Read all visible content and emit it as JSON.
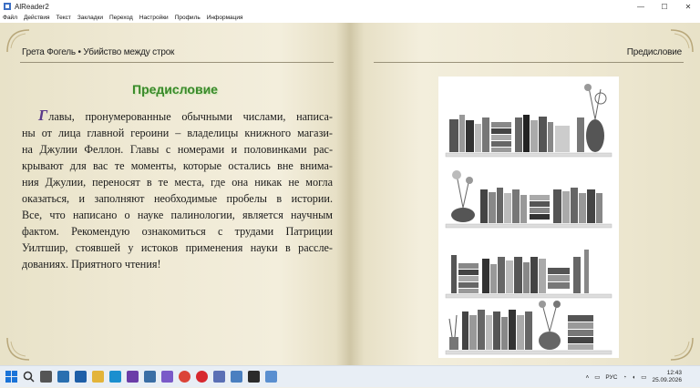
{
  "window": {
    "title": "AlReader2",
    "minimize_label": "—",
    "maximize_label": "☐",
    "close_label": "✕"
  },
  "menu": [
    "Файл",
    "Действия",
    "Текст",
    "Закладки",
    "Переход",
    "Настройки",
    "Профиль",
    "Информация"
  ],
  "book": {
    "left_header": "Грета Фогель  • Убийство между строк",
    "right_header": "Предисловие",
    "chapter_title": "Предисловие",
    "dropcap": "Г",
    "lines": [
      "лавы, пронумерованные обычными числами, написа-",
      "ны от лица главной героини – владелицы книжного магази-",
      "на Джулии Феллон. Главы с номерами и половинками рас-",
      "крывают для вас те моменты, которые остались вне внима-",
      "ния Джулии, переносят в те места, где она никак не могла",
      "оказаться, и заполняют необходимые пробелы в истории.",
      "Все, что написано о науке палинологии, является научным",
      "фактом. Рекомендую ознакомиться с трудами Патриции",
      "Уилтшир, стоявшей у истоков применения науки в рассле-",
      "дованиях. Приятного чтения!"
    ]
  },
  "taskbar": {
    "icons": [
      "windows-start-icon",
      "search-icon",
      "task-view-icon",
      "widgets-icon",
      "store-icon",
      "file-explorer-icon",
      "edge-icon",
      "app-icon-1",
      "app-icon-2",
      "app-icon-3",
      "chrome-icon",
      "opera-icon",
      "app-icon-4",
      "app-icon-5",
      "app-icon-6",
      "alreader-icon"
    ],
    "colors": [
      "#1a73d8",
      "#444",
      "#555",
      "#2a6fb0",
      "#1e5fa8",
      "#e3b43a",
      "#1b8fcf",
      "#6b3da8",
      "#3a6ea5",
      "#7a5ac8",
      "#db4437",
      "#d7282f",
      "#5a6fb5",
      "#4a7fc0",
      "#2b2b2b",
      "#5a8fd0"
    ],
    "lang": "РУС",
    "time": "12:43",
    "date": "25.09.2026"
  }
}
